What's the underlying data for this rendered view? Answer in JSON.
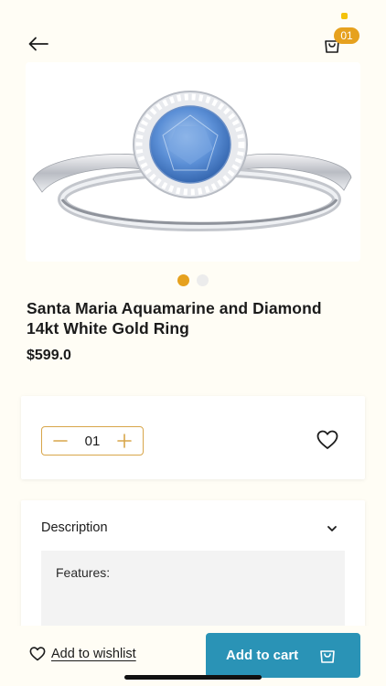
{
  "header": {
    "cart_count": "01"
  },
  "product": {
    "title": "Santa Maria Aquamarine and Diamond 14kt White Gold Ring",
    "price": "$599.0",
    "gallery": {
      "image_count": 2,
      "active_index": 0
    }
  },
  "quantity": {
    "value": "01"
  },
  "description": {
    "heading": "Description",
    "body_label": "Features:"
  },
  "bottom_bar": {
    "wishlist_label": "Add to wishlist",
    "add_to_cart_label": "Add to cart"
  },
  "colors": {
    "accent": "#e6a11e",
    "primary_button": "#2a93b6",
    "background": "#fffdf5"
  },
  "icons": [
    "arrow-left-icon",
    "shopping-bag-icon",
    "minus-icon",
    "plus-icon",
    "heart-icon",
    "chevron-down-icon"
  ]
}
